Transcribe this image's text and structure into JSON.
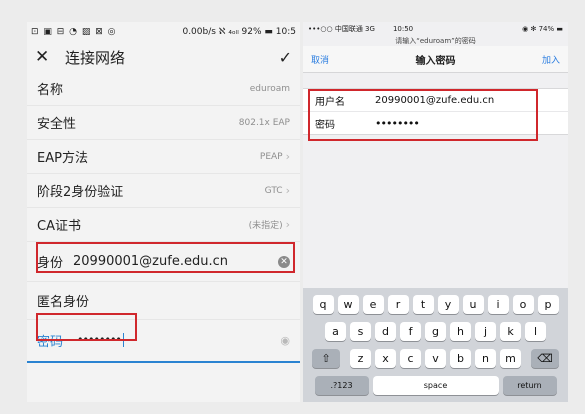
{
  "android": {
    "status": {
      "left_icons": "⊡ ▣ ⊟ ◔ ▨ ⊠ ◎",
      "right": "0.00b/s ℵ ₄ₒₗₗ 92% ▬ 10:5"
    },
    "toolbar": {
      "close": "✕",
      "title": "连接网络",
      "confirm": "✓"
    },
    "rows": [
      {
        "label": "名称",
        "value": "eduroam",
        "chevron": ""
      },
      {
        "label": "安全性",
        "value": "802.1x EAP",
        "chevron": ""
      },
      {
        "label": "EAP方法",
        "value": "PEAP",
        "chevron": "›"
      },
      {
        "label": "阶段2身份验证",
        "value": "GTC",
        "chevron": "›"
      },
      {
        "label": "CA证书",
        "value": "(未指定)",
        "chevron": "›"
      }
    ],
    "identity": {
      "label": "身份",
      "value": "20990001@zufe.edu.cn",
      "clear_icon": "⊗"
    },
    "anonymous": {
      "label": "匿名身份"
    },
    "password": {
      "label": "密码",
      "value": "••••••••",
      "eye_icon": "◉"
    }
  },
  "ios": {
    "status": {
      "carrier": "•••○○ 中国联通  3G",
      "time": "10:50",
      "right": "◉ ✻ 74% ▬"
    },
    "prompt": "请输入“eduroam”的密码",
    "nav": {
      "cancel": "取消",
      "title": "输入密码",
      "join": "加入"
    },
    "form": {
      "username_label": "用户名",
      "username_value": "20990001@zufe.edu.cn",
      "password_label": "密码",
      "password_value": "••••••••"
    },
    "keyboard": {
      "row1": [
        "q",
        "w",
        "e",
        "r",
        "t",
        "y",
        "u",
        "i",
        "o",
        "p"
      ],
      "row2": [
        "a",
        "s",
        "d",
        "f",
        "g",
        "h",
        "j",
        "k",
        "l"
      ],
      "row3": [
        "z",
        "x",
        "c",
        "v",
        "b",
        "n",
        "m"
      ],
      "shift": "⇧",
      "delete": "⌫",
      "numbers": ".?123",
      "space": "space",
      "return": "return"
    }
  },
  "colors": {
    "highlight_red": "#d0272c",
    "android_accent": "#2a83d1",
    "ios_accent": "#2b7de0"
  }
}
